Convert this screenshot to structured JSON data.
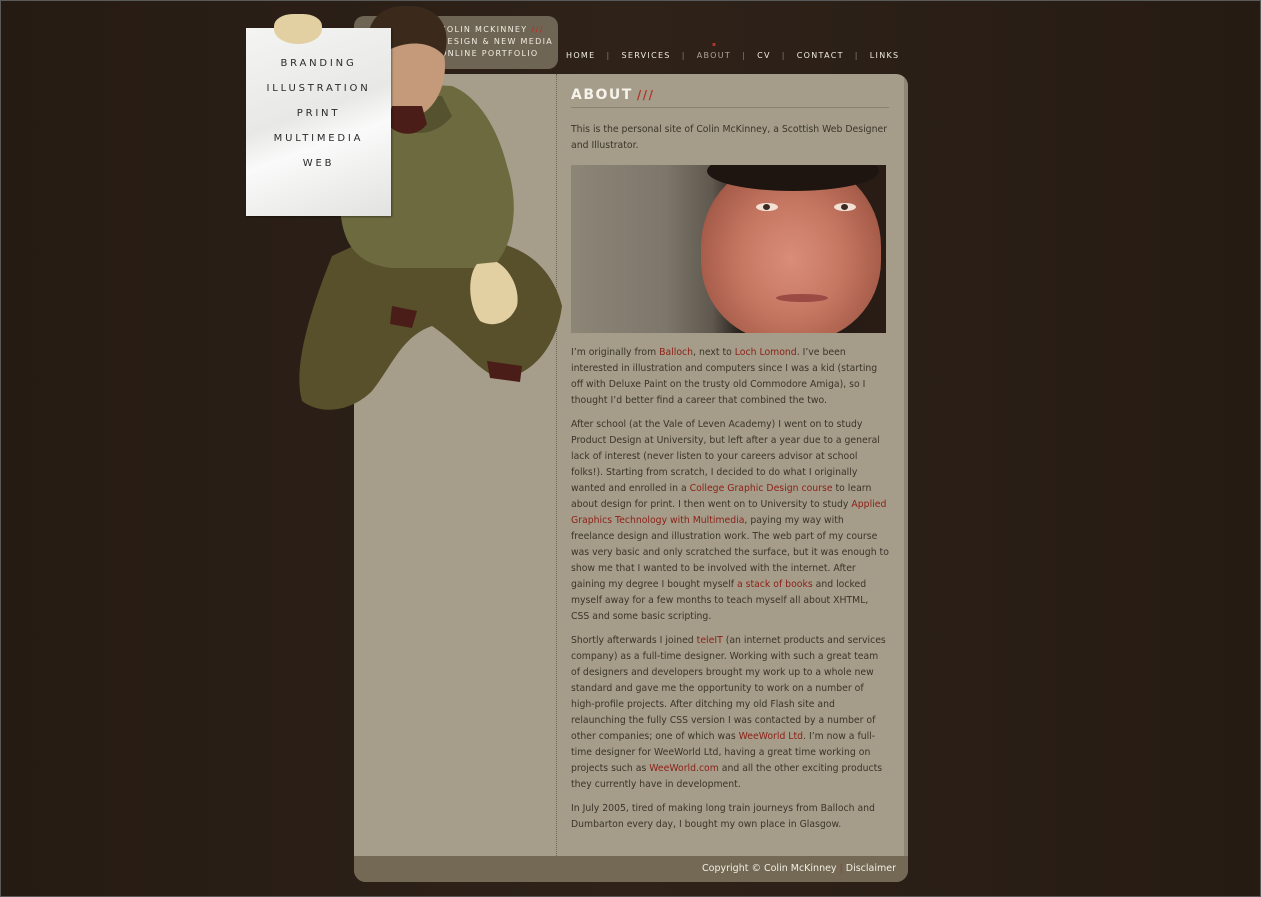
{
  "header": {
    "title_lines": [
      "Colin McKinney",
      "Design & New Media",
      "Online Portfolio"
    ],
    "title_suffix": "///"
  },
  "nav": {
    "items": [
      "Home",
      "Services",
      "About",
      "CV",
      "Contact",
      "Links"
    ],
    "separator": "|",
    "active": "About"
  },
  "side_menu": {
    "items": [
      "Branding",
      "Illustration",
      "Print",
      "Multimedia",
      "Web"
    ]
  },
  "content": {
    "heading": "About",
    "heading_suffix": "///",
    "intro": "This is the personal site of Colin McKinney, a Scottish Web Designer and Illustrator.",
    "p1": {
      "a": "I’m originally from ",
      "link1": "Balloch",
      "b": ", next to ",
      "link2": "Loch Lomond",
      "c": ". I’ve been interested in illustration and computers since I was a kid (starting off with Deluxe Paint on the trusty old Commodore Amiga), so I thought I’d better find a career that combined the two."
    },
    "p2": {
      "a": "After school (at the Vale of Leven Academy) I went on to study Product Design at University, but left after a year due to a general lack of interest (never listen to your careers advisor at school folks!). Starting from scratch, I decided to do what I originally wanted and enrolled in a ",
      "link1": "College Graphic Design course",
      "b": " to learn about design for print. I then went on to University to study ",
      "link2": "Applied Graphics Technology with Multimedia",
      "c": ", paying my way with freelance design and illustration work. The web part of my course was very basic and only scratched the surface, but it was enough to show me that I wanted to be involved with the internet. After gaining my degree I bought myself ",
      "link3": "a stack of books",
      "d": " and locked myself away for a few months to teach myself all about XHTML, CSS and some basic scripting."
    },
    "p3": {
      "a": "Shortly afterwards I joined ",
      "link1": "teleIT",
      "b": " (an internet products and services company) as a full-time designer. Working with such a great team of designers and developers brought my work up to a whole new standard and gave me the opportunity to work on a number of high-profile projects. After ditching my old Flash site and relaunching the fully CSS version I was contacted by a number of other companies; one of which was ",
      "link2": "WeeWorld Ltd",
      "c": ". I’m now a full-time designer for WeeWorld Ltd, having a great time working on projects such as ",
      "link3": "WeeWorld.com",
      "d": " and all the other exciting products they currently have in development."
    },
    "p4": "In July 2005, tired of making long train journeys from Balloch and Dumbarton every day, I bought my own place in Glasgow."
  },
  "footer": {
    "copyright": "Copyright © Colin McKinney",
    "separator": "|",
    "disclaimer": "Disclaimer"
  },
  "colors": {
    "background": "#2b1f17",
    "panel": "#a59d89",
    "accent_red": "#b0342c",
    "link": "#8c1f17",
    "footer": "#736955"
  }
}
